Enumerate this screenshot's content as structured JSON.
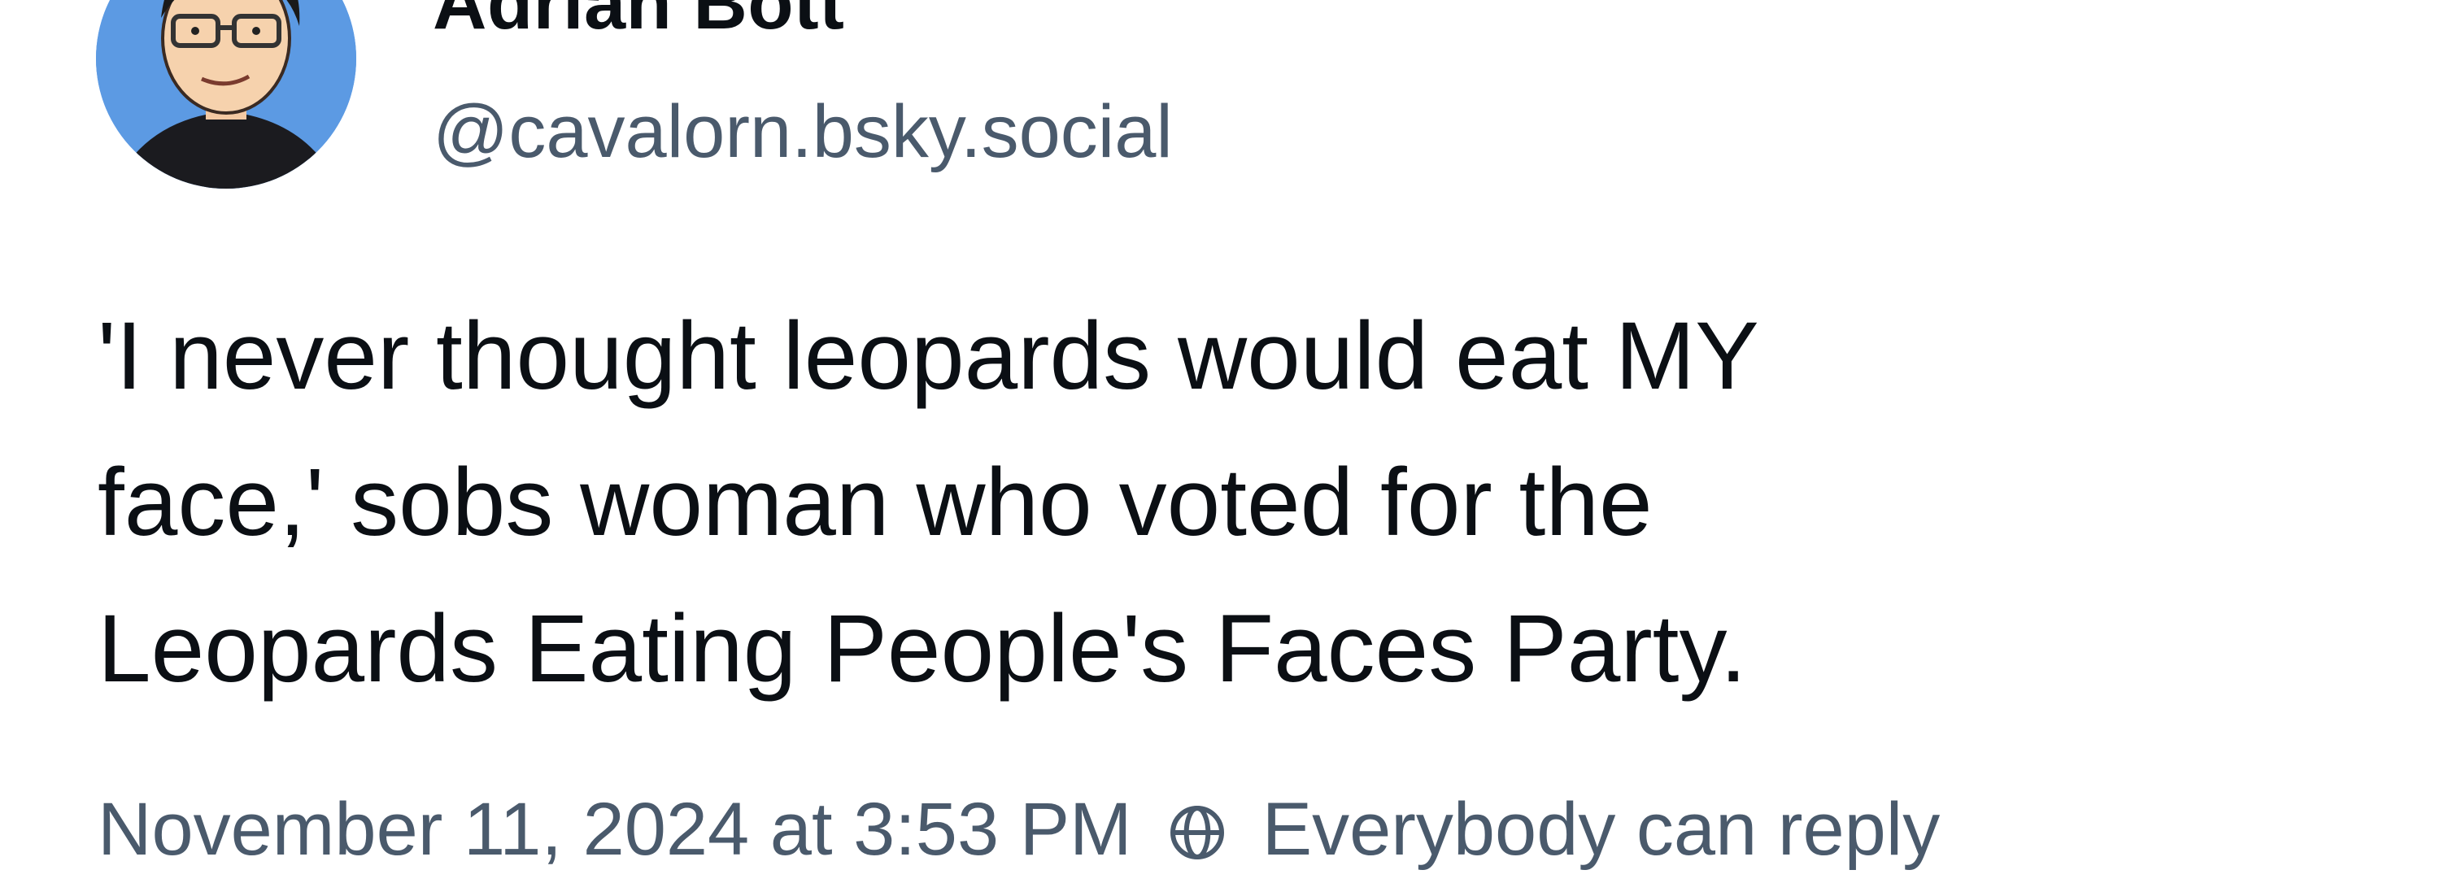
{
  "author": {
    "display_name": "Adrian Bott",
    "handle": "@cavalorn.bsky.social",
    "avatar_icon": "cartoon-avatar-icon",
    "avatar_bg": "#5c9ae3"
  },
  "post": {
    "lines": [
      "'I never thought leopards would eat MY",
      "face,' sobs woman who voted for the",
      "Leopards Eating People's Faces Party."
    ]
  },
  "meta": {
    "timestamp": "November 11, 2024 at 3:53 PM",
    "visibility_icon": "globe-icon",
    "visibility_label": "Everybody can reply"
  },
  "colors": {
    "text_primary": "#0b0f14",
    "text_secondary": "#4a5a6c"
  }
}
